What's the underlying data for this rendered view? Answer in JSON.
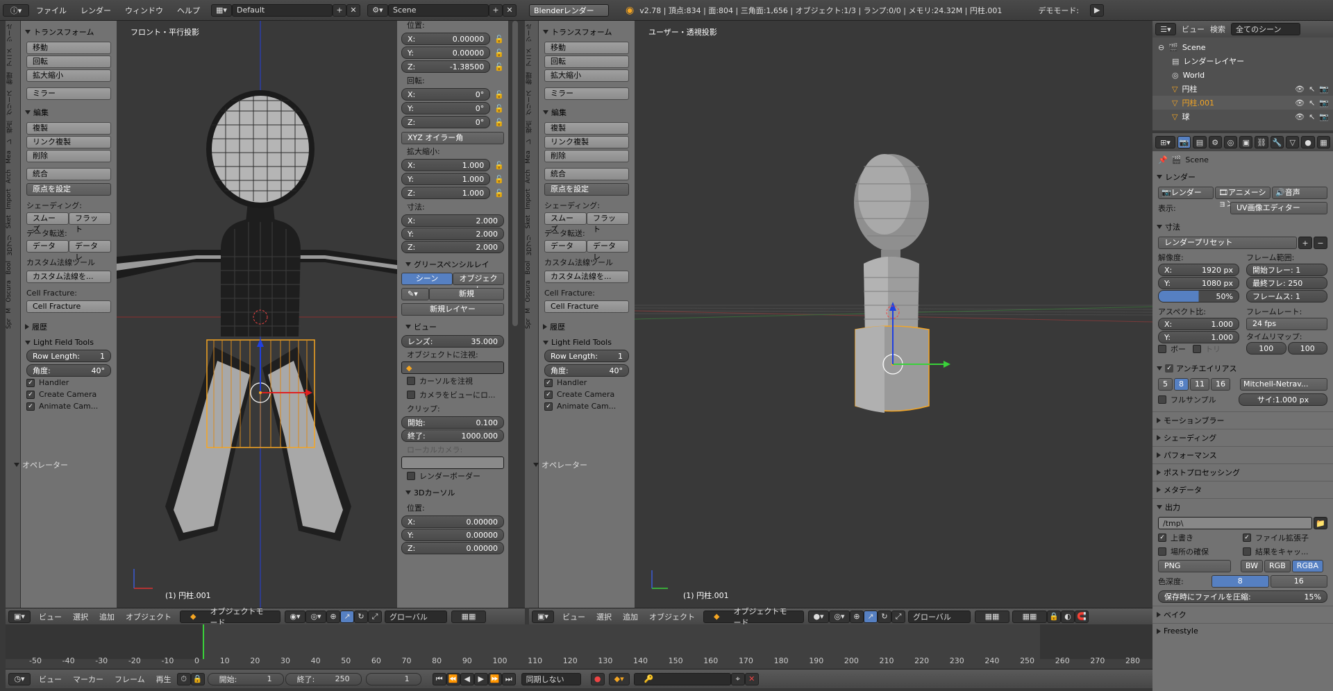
{
  "topbar": {
    "menus": [
      "ファイル",
      "レンダー",
      "ウィンドウ",
      "ヘルプ"
    ],
    "layout": "Default",
    "scene": "Scene",
    "engine": "Blenderレンダー",
    "stats": "v2.78 | 頂点:834 | 面:804 | 三角面:1,656 | オブジェクト:1/3 | ランプ:0/0 | メモリ:24.32M | 円柱.001",
    "demo": "デモモード:"
  },
  "tool_tabs": [
    "ツール",
    "アニメ",
    "物理",
    "グリース",
    "視点",
    "レ",
    "Mea",
    "Arch",
    "Import",
    "Sket",
    "3Dプリ",
    "Bool",
    "Oscura",
    "M",
    "Spr"
  ],
  "toolshelf": {
    "transform_header": "トランスフォーム",
    "transform_buttons": [
      "移動",
      "回転",
      "拡大縮小"
    ],
    "mirror": "ミラー",
    "edit_header": "編集",
    "edit_buttons": [
      "複製",
      "リンク複製",
      "削除"
    ],
    "join": "統合",
    "origin": "原点を設定",
    "shading_label": "シェーディング:",
    "smooth": "スムーズ",
    "flat": "フラット",
    "data_transfer_label": "データ転送:",
    "data": "データ",
    "data_layout": "データレ",
    "custom_normal_tools": "カスタム法線ツール",
    "custom_normal_btn": "カスタム法線を...",
    "cell_fracture_label": "Cell Fracture:",
    "cell_fracture_btn": "Cell Fracture",
    "history_header": "履歴",
    "lft_header": "Light Field Tools",
    "row_length": "Row Length:",
    "row_length_value": "1",
    "angle": "角度:",
    "angle_value": "40°",
    "handler": "Handler",
    "create_camera": "Create Camera",
    "animate_cam": "Animate Cam...",
    "operator_header": "オペレーター"
  },
  "left_view": {
    "label": "フロント・平行投影",
    "object": "(1) 円柱.001"
  },
  "right_view": {
    "label": "ユーザー・透視投影",
    "object": "(1) 円柱.001"
  },
  "npanel": {
    "location_label": "位置:",
    "loc": [
      {
        "k": "X:",
        "v": "0.00000"
      },
      {
        "k": "Y:",
        "v": "0.00000"
      },
      {
        "k": "Z:",
        "v": "-1.38500"
      }
    ],
    "rotation_label": "回転:",
    "rot": [
      {
        "k": "X:",
        "v": "0°"
      },
      {
        "k": "Y:",
        "v": "0°"
      },
      {
        "k": "Z:",
        "v": "0°"
      }
    ],
    "euler": "XYZ オイラー角",
    "scale_label": "拡大縮小:",
    "scale": [
      {
        "k": "X:",
        "v": "1.000"
      },
      {
        "k": "Y:",
        "v": "1.000"
      },
      {
        "k": "Z:",
        "v": "1.000"
      }
    ],
    "dims_label": "寸法:",
    "dims": [
      {
        "k": "X:",
        "v": "2.000"
      },
      {
        "k": "Y:",
        "v": "2.000"
      },
      {
        "k": "Z:",
        "v": "2.000"
      }
    ],
    "gp_header": "グリースペンシルレイ",
    "gp_scene": "シーン",
    "gp_object": "オブジェクト",
    "gp_new": "新規",
    "gp_new_layer": "新規レイヤー",
    "view_header": "ビュー",
    "lens_label": "レンズ:",
    "lens": "35.000",
    "lock_obj": "オブジェクトに注視:",
    "lock_cursor": "カーソルを注視",
    "lock_cam": "カメラをビューにロ...",
    "clip_label": "クリップ:",
    "clip_start_k": "開始:",
    "clip_start": "0.100",
    "clip_end_k": "終了:",
    "clip_end": "1000.000",
    "local_cam": "ローカルカメラ:",
    "render_border": "レンダーボーダー",
    "cursor_header": "3Dカーソル",
    "cursor_loc_label": "位置:",
    "cursor": [
      {
        "k": "X:",
        "v": "0.00000"
      },
      {
        "k": "Y:",
        "v": "0.00000"
      },
      {
        "k": "Z:",
        "v": "0.00000"
      }
    ]
  },
  "view_header": {
    "view": "ビュー",
    "select": "選択",
    "add": "追加",
    "object": "オブジェクト",
    "mode": "オブジェクトモード",
    "orient": "グローバル"
  },
  "outliner": {
    "view": "ビュー",
    "search": "検索",
    "scope": "全てのシーン",
    "items": [
      {
        "name": "Scene",
        "indent": 0
      },
      {
        "name": "レンダーレイヤー",
        "indent": 1
      },
      {
        "name": "World",
        "indent": 1
      },
      {
        "name": "円柱",
        "indent": 1
      },
      {
        "name": "円柱.001",
        "indent": 1
      },
      {
        "name": "球",
        "indent": 1
      }
    ]
  },
  "properties": {
    "scene": "Scene",
    "render_header": "レンダー",
    "render_btn": "レンダー",
    "anim_btn": "アニメーション",
    "audio_btn": "音声",
    "display_label": "表示:",
    "display_value": "UV画像エディター",
    "dims_header": "寸法",
    "preset": "レンダープリセット",
    "res_label": "解像度:",
    "res_x": "1920 px",
    "res_y": "1080 px",
    "res_pct": "50%",
    "frame_range_label": "フレーム範囲:",
    "start_frame": "開始フレー: 1",
    "end_frame": "最終フレ: 250",
    "frame_step": "フレームス: 1",
    "aspect_label": "アスペクト比:",
    "aspect_x": "1.000",
    "aspect_y": "1.000",
    "framerate_label": "フレームレート:",
    "fps": "24 fps",
    "timeremap_label": "タイムリマップ:",
    "remap_old": "100",
    "remap_new": "100",
    "border": "ボー",
    "crop": "トリ",
    "aa_header": "アンチエイリアス",
    "aa_samples": [
      "5",
      "8",
      "11",
      "16"
    ],
    "aa_filter": "Mitchell-Netrav...",
    "full_sample": "フルサンプル",
    "filter_size": "サイ:1.000 px",
    "motion_blur": "モーションブラー",
    "shading": "シェーディング",
    "performance": "パフォーマンス",
    "post": "ポストプロセッシング",
    "metadata": "メタデータ",
    "output_header": "出力",
    "output_path": "/tmp\\",
    "overwrite": "上書き",
    "file_ext": "ファイル拡張子",
    "placeholders": "場所の確保",
    "cache_result": "結果をキャッ...",
    "format": "PNG",
    "bw": "BW",
    "rgb": "RGB",
    "rgba": "RGBA",
    "depth_label": "色深度:",
    "depth8": "8",
    "depth16": "16",
    "compress": "保存時にファイルを圧縮:",
    "compress_val": "15%",
    "bake": "ベイク",
    "freestyle": "Freestyle"
  },
  "timeline": {
    "ticks": [
      "-50",
      "-40",
      "-30",
      "-20",
      "-10",
      "0",
      "10",
      "20",
      "30",
      "40",
      "50",
      "60",
      "70",
      "80",
      "90",
      "100",
      "110",
      "120",
      "130",
      "140",
      "150",
      "160",
      "170",
      "180",
      "190",
      "200",
      "210",
      "220",
      "230",
      "240",
      "250",
      "260",
      "270",
      "280"
    ],
    "view": "ビュー",
    "marker": "マーカー",
    "frame": "フレーム",
    "playback": "再生",
    "start_label": "開始:",
    "start": "1",
    "end_label": "終了:",
    "end": "250",
    "current": "1",
    "sync": "同期しない"
  }
}
